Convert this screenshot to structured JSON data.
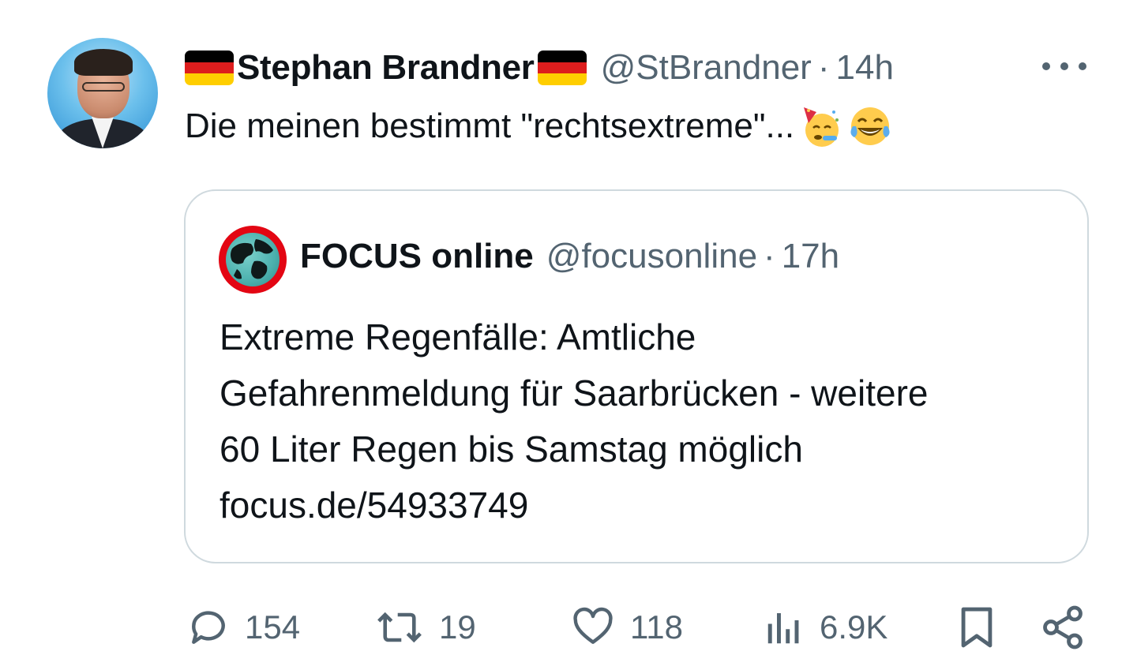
{
  "author": {
    "name": "Stephan Brandner",
    "handle": "@StBrandner",
    "time": "14h"
  },
  "tweet": {
    "text": "Die meinen bestimmt \"rechtsextreme\"...",
    "emojis": [
      "partying-face-emoji",
      "tears-of-joy-emoji"
    ]
  },
  "quoted": {
    "name": "FOCUS online",
    "handle": "@focusonline",
    "time": "17h",
    "lines": [
      "Extreme Regenfälle: Amtliche",
      "Gefahrenmeldung für Saarbrücken - weitere",
      "60 Liter Regen bis Samstag möglich",
      "focus.de/54933749"
    ]
  },
  "actions": {
    "replies": "154",
    "reposts": "19",
    "likes": "118",
    "views": "6.9K"
  },
  "colors": {
    "text": "#0f1419",
    "muted": "#536471",
    "border": "#cfd9de",
    "flag_black": "#000000",
    "flag_red": "#dd1d1d",
    "flag_gold": "#ffce00"
  }
}
